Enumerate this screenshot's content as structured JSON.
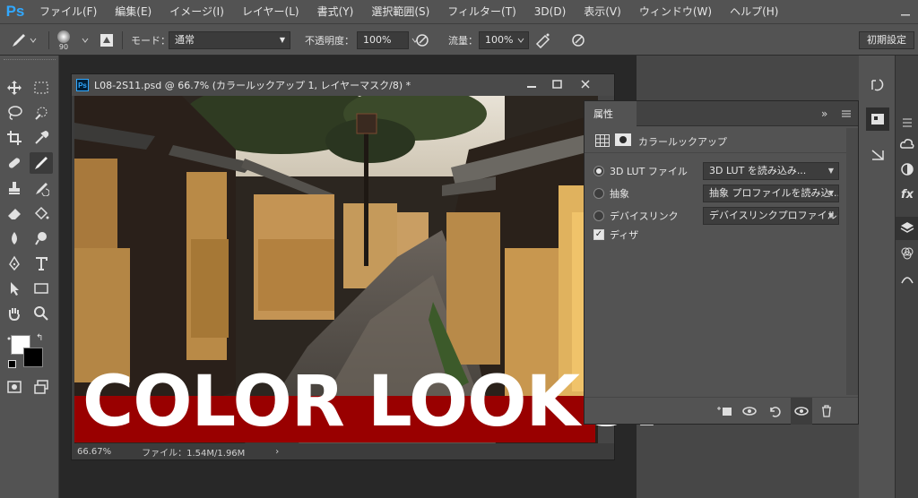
{
  "app": {
    "logo": "Ps"
  },
  "menu": [
    "ファイル(F)",
    "編集(E)",
    "イメージ(I)",
    "レイヤー(L)",
    "書式(Y)",
    "選択範囲(S)",
    "フィルター(T)",
    "3D(D)",
    "表示(V)",
    "ウィンドウ(W)",
    "ヘルプ(H)"
  ],
  "options": {
    "brush_size": "90",
    "mode_label": "モード：",
    "mode_value": "通常",
    "opacity_label": "不透明度：",
    "opacity_value": "100%",
    "flow_label": "流量：",
    "flow_value": "100%",
    "workspace": "初期設定"
  },
  "document": {
    "title": "L08-2S11.psd @ 66.7% (カラールックアップ 1, レイヤーマスク/8) *",
    "zoom": "66.67%",
    "file_info": "ファイル：1.54M/1.96M",
    "overlay_title": "COLOR LOOKUP"
  },
  "properties": {
    "tab": "属性",
    "adjustment_name": "カラールックアップ",
    "rows": [
      {
        "label": "3D LUT ファイル",
        "value": "3D LUT を読み込み...",
        "selected": true
      },
      {
        "label": "抽象",
        "value": "抽象 プロファイルを読み込...",
        "selected": false
      },
      {
        "label": "デバイスリンク",
        "value": "デバイスリンクプロファイルを...",
        "selected": false
      }
    ],
    "dither_label": "ディザ",
    "dither_checked": true
  },
  "colors": {
    "ps_blue": "#31a8ff",
    "banner_red": "#990000",
    "panel_bg": "#535353"
  }
}
